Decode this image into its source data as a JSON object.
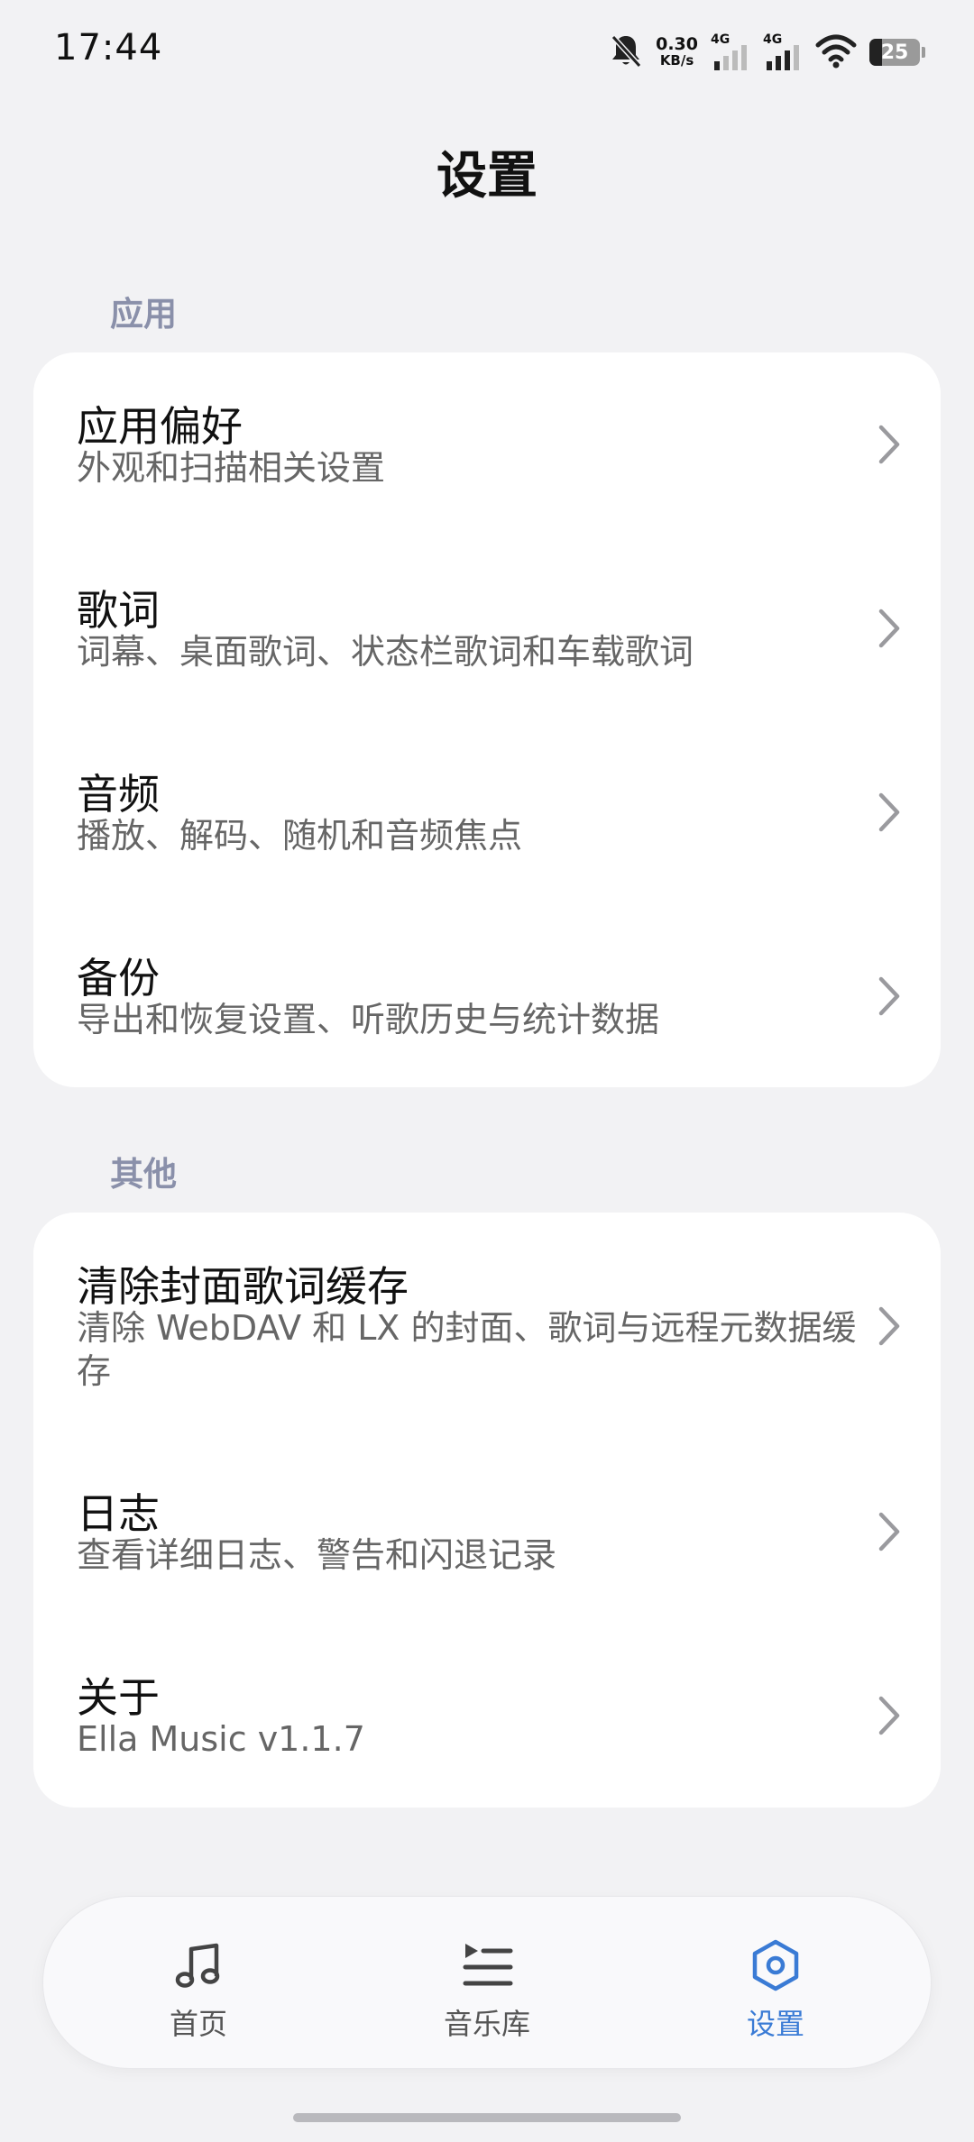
{
  "status_bar": {
    "time": "17:44",
    "net_speed_value": "0.30",
    "net_speed_unit": "KB/s",
    "sim1_label": "4G",
    "sim2_label": "4G",
    "battery": "25",
    "icons": [
      "bell-off-icon",
      "signal-icon",
      "signal-icon",
      "wifi-icon",
      "battery-icon"
    ]
  },
  "page": {
    "title": "设置"
  },
  "sections": [
    {
      "label": "应用",
      "items": [
        {
          "title": "应用偏好",
          "subtitle": "外观和扫描相关设置"
        },
        {
          "title": "歌词",
          "subtitle": "词幕、桌面歌词、状态栏歌词和车载歌词"
        },
        {
          "title": "音频",
          "subtitle": "播放、解码、随机和音频焦点"
        },
        {
          "title": "备份",
          "subtitle": "导出和恢复设置、听歌历史与统计数据"
        }
      ]
    },
    {
      "label": "其他",
      "items": [
        {
          "title": "清除封面歌词缓存",
          "subtitle": "清除 WebDAV 和 LX 的封面、歌词与远程元数据缓存"
        },
        {
          "title": "日志",
          "subtitle": "查看详细日志、警告和闪退记录"
        },
        {
          "title": "关于",
          "subtitle": "Ella Music v1.1.7"
        }
      ]
    }
  ],
  "bottom_nav": {
    "items": [
      {
        "label": "首页",
        "icon": "music-note-icon",
        "active": false
      },
      {
        "label": "音乐库",
        "icon": "playlist-icon",
        "active": false
      },
      {
        "label": "设置",
        "icon": "settings-hexagon-icon",
        "active": true
      }
    ]
  },
  "colors": {
    "background": "#f2f2f4",
    "card": "#ffffff",
    "section_label": "#8a90aa",
    "accent": "#3a7bd5"
  }
}
